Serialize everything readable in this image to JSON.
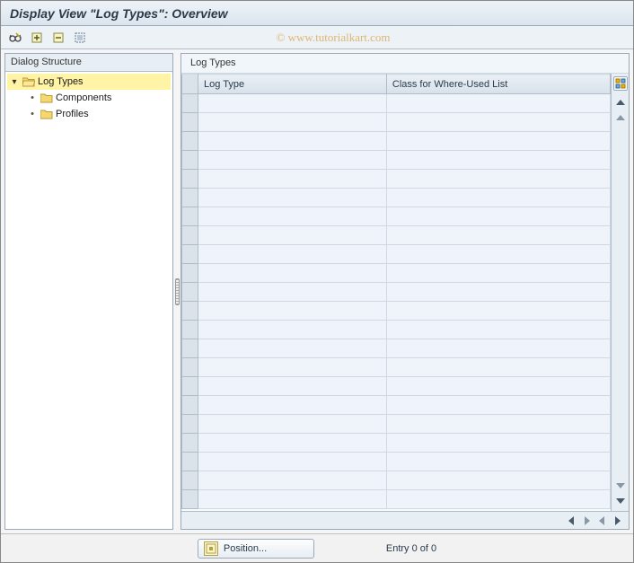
{
  "window_title": "Display View \"Log Types\": Overview",
  "watermark": "© www.tutorialkart.com",
  "toolbar_icons": [
    "toggle-edit",
    "expand-all",
    "collapse-all",
    "select-block"
  ],
  "tree": {
    "header": "Dialog Structure",
    "root": {
      "label": "Log Types",
      "expanded": true,
      "selected": true
    },
    "children": [
      {
        "label": "Components"
      },
      {
        "label": "Profiles"
      }
    ]
  },
  "table": {
    "title": "Log Types",
    "columns": [
      "Log Type",
      "Class for Where-Used List"
    ],
    "visible_row_count": 22,
    "rows": []
  },
  "footer": {
    "position_button": "Position...",
    "entry_count": "Entry 0 of 0"
  }
}
